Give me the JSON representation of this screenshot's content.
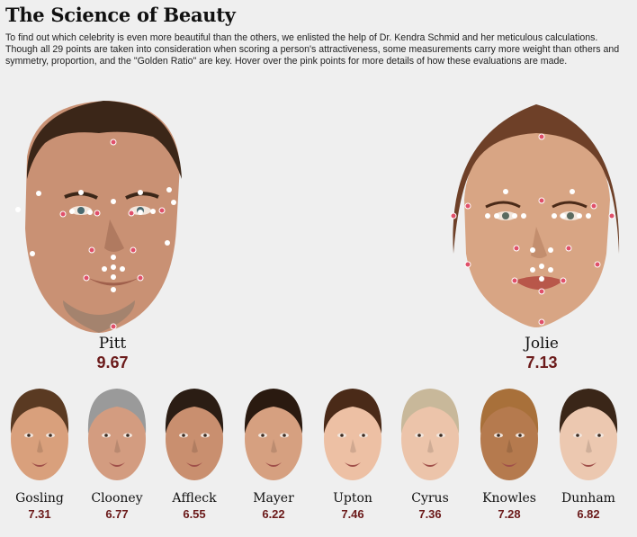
{
  "header": {
    "title": "The Science of Beauty",
    "intro": "To find out which celebrity is even more beautiful than the others, we enlisted the help of Dr. Kendra Schmid and her meticulous calculations. Though all 29 points are taken into consideration when scoring a person's attractiveness, some measurements carry more weight than others and symmetry, proportion, and the \"Golden Ratio\" are key. Hover over the pink points for more details of how these evaluations are made."
  },
  "featured": [
    {
      "name": "Pitt",
      "score": "9.67",
      "icon": "male-face-portrait"
    },
    {
      "name": "Jolie",
      "score": "7.13",
      "icon": "female-face-portrait"
    }
  ],
  "others": [
    {
      "name": "Gosling",
      "score": "7.31",
      "hair": "#5a3a22",
      "skin": "#d9a07c"
    },
    {
      "name": "Clooney",
      "score": "6.77",
      "hair": "#9a9a9a",
      "skin": "#d39c80"
    },
    {
      "name": "Affleck",
      "score": "6.55",
      "hair": "#2b1d14",
      "skin": "#c98f6f"
    },
    {
      "name": "Mayer",
      "score": "6.22",
      "hair": "#2a1a10",
      "skin": "#d6a080"
    },
    {
      "name": "Upton",
      "score": "7.46",
      "hair": "#4a2a18",
      "skin": "#edc0a4"
    },
    {
      "name": "Cyrus",
      "score": "7.36",
      "hair": "#c8b89a",
      "skin": "#ecc4aa"
    },
    {
      "name": "Knowles",
      "score": "7.28",
      "hair": "#a8703a",
      "skin": "#b57a4e"
    },
    {
      "name": "Dunham",
      "score": "6.82",
      "hair": "#3a2618",
      "skin": "#ecc8b0"
    }
  ],
  "colors": {
    "score": "#6b1a1a",
    "pink_point": "#e0506a",
    "white_point": "#ffffff",
    "background": "#efefef"
  }
}
